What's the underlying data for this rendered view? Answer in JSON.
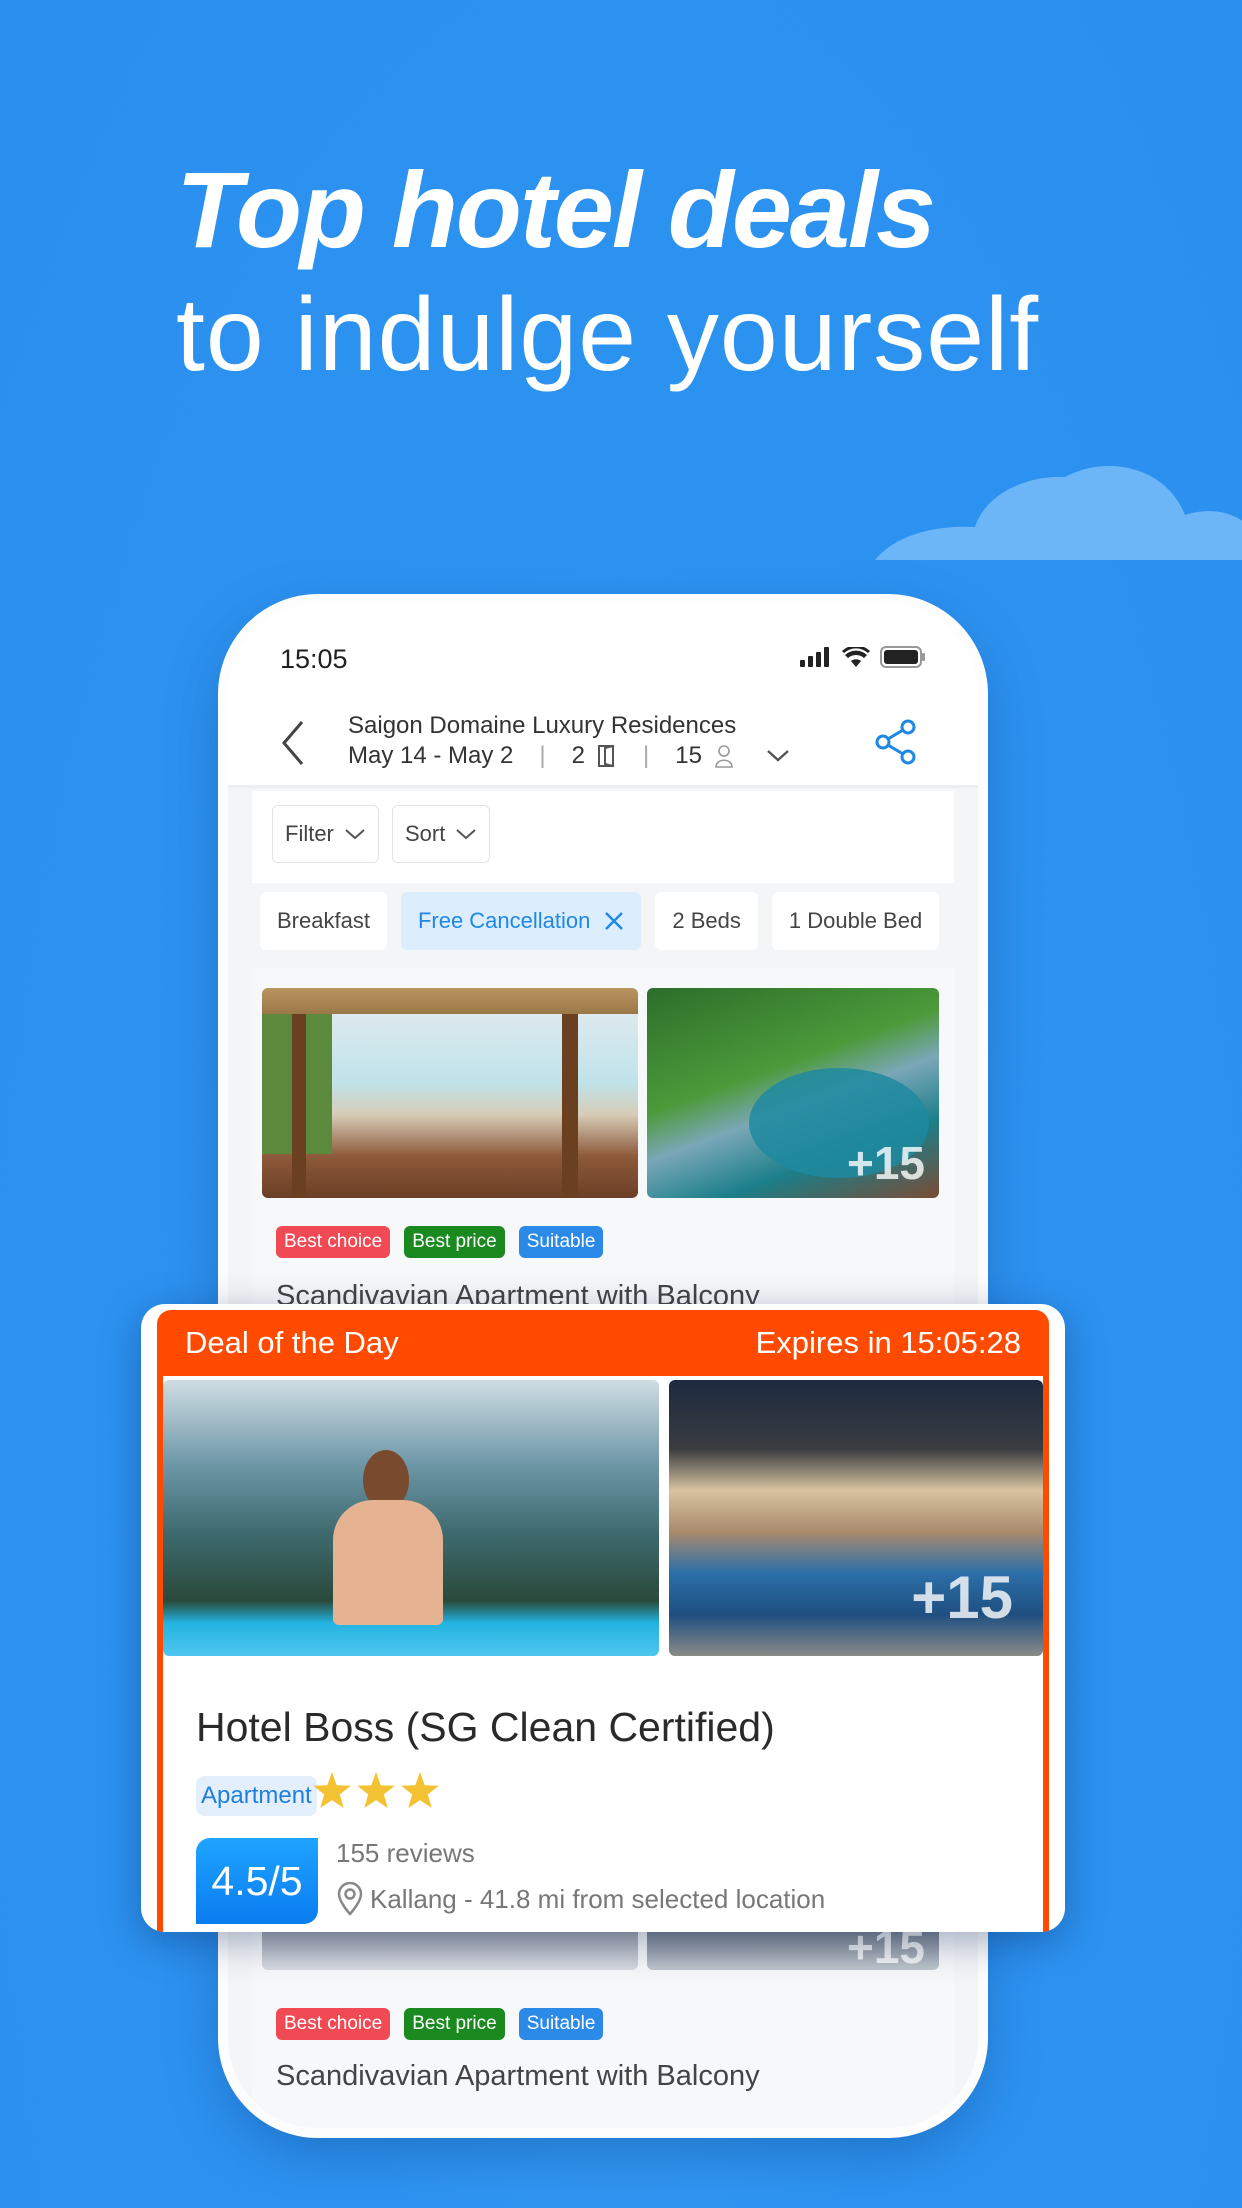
{
  "headline": {
    "line1": "Top hotel deals",
    "line2": "to indulge yourself"
  },
  "status_bar": {
    "time": "15:05",
    "icons": [
      "signal-icon",
      "wifi-icon",
      "battery-icon"
    ]
  },
  "header": {
    "hotel_name": "Saigon Domaine Luxury Residences",
    "dates": "May 14 - May 2",
    "rooms": "2",
    "guests": "15",
    "icons": [
      "back-icon",
      "door-icon",
      "person-icon",
      "chevron-down-icon",
      "share-icon"
    ]
  },
  "toolbar": {
    "filter_label": "Filter",
    "sort_label": "Sort"
  },
  "chips": [
    {
      "label": "Breakfast",
      "active": false
    },
    {
      "label": "Free Cancellation",
      "active": true
    },
    {
      "label": "2 Beds",
      "active": false
    },
    {
      "label": "1 Double Bed",
      "active": false
    }
  ],
  "listing": {
    "photo_more": "+15",
    "tags": [
      "Best choice",
      "Best price",
      "Suitable"
    ],
    "title": "Scandivavian Apartment with Balcony"
  },
  "listing2": {
    "photo_more": "+15",
    "tags": [
      "Best choice",
      "Best price",
      "Suitable"
    ],
    "title": "Scandivavian Apartment with Balcony"
  },
  "deal": {
    "label": "Deal of the Day",
    "expires": "Expires in 15:05:28",
    "photo_more": "+15",
    "hotel_name": "Hotel Boss (SG Clean Certified)",
    "type": "Apartment",
    "star_rating": 3,
    "score": "4.5/5",
    "reviews": "155 reviews",
    "location": "Kallang - 41.8 mi from selected location"
  },
  "colors": {
    "background": "#2d93f1",
    "accent_blue": "#1e88e5",
    "deal_orange": "#ff4a00",
    "tag_red": "#f04a55",
    "tag_green": "#1a8a20",
    "tag_blue": "#2b8ae8",
    "star": "#f2c232"
  }
}
